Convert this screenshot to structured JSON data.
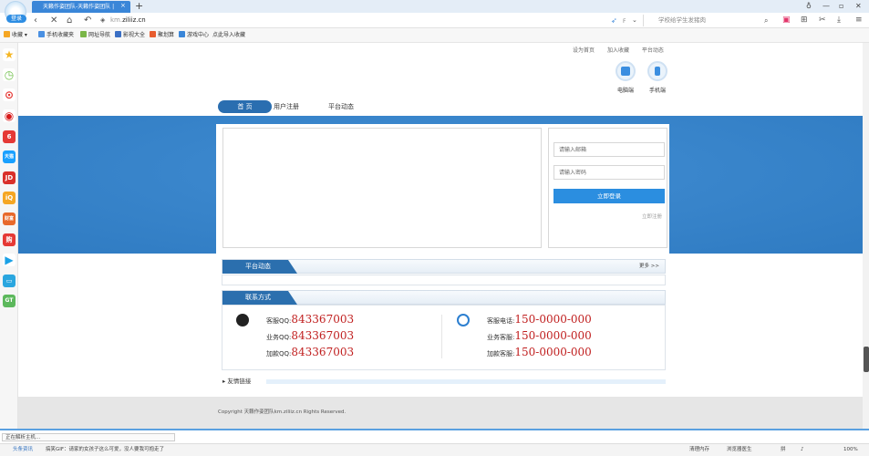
{
  "browser": {
    "login_label": "登录",
    "tab_title": "天籁作姿团队-天籁作姿团队 |",
    "tab_close": "×",
    "new_tab": "+",
    "address_prefix": "km.",
    "address_domain": "ziliiz.cn",
    "search_engine_label": "F",
    "search_placeholder": "学校给学生发猪肉",
    "icons": [
      "back-icon",
      "close-icon",
      "home-icon",
      "undo-icon",
      "shield-icon",
      "lightning-icon",
      "search-icon",
      "minimize-icon",
      "maximize-icon",
      "window-close-icon",
      "menu-icon"
    ]
  },
  "bookmarks": [
    {
      "label": "收藏",
      "color": "#f5a623"
    },
    {
      "label": "手机收藏夹",
      "color": "#4a90e2"
    },
    {
      "label": "网址导航",
      "color": "#7ab648"
    },
    {
      "label": "影视大全",
      "color": "#3a6fc4"
    },
    {
      "label": "聚划算",
      "color": "#e85d2f"
    },
    {
      "label": "游戏中心",
      "color": "#3a86d8"
    },
    {
      "label": "点此导入收藏",
      "color": "#cccccc"
    }
  ],
  "sidebar": [
    {
      "name": "favorites",
      "glyph": "★",
      "bg": "#f5b623"
    },
    {
      "name": "history",
      "glyph": "◷",
      "bg": "#6fbf4a"
    },
    {
      "name": "video",
      "glyph": "▶",
      "bg": "#e53935"
    },
    {
      "name": "live",
      "glyph": "●",
      "bg": "#d81b1b"
    },
    {
      "name": "weibo",
      "glyph": "6",
      "bg": "#e53935"
    },
    {
      "name": "tmall",
      "glyph": "天猫",
      "bg": "#19a0ff"
    },
    {
      "name": "jd",
      "glyph": "JD",
      "bg": "#d9302a"
    },
    {
      "name": "iqiyi",
      "glyph": "iQ",
      "bg": "#f5a623"
    },
    {
      "name": "finance",
      "glyph": "财富",
      "bg": "#e8692b"
    },
    {
      "name": "shop",
      "glyph": "购",
      "bg": "#e53935"
    },
    {
      "name": "player",
      "glyph": "▶",
      "bg": "#1aa1e6"
    },
    {
      "name": "tv",
      "glyph": "☐",
      "bg": "#2aa6df"
    },
    {
      "name": "app",
      "glyph": "GT",
      "bg": "#5cb85c"
    }
  ],
  "site": {
    "top_links": [
      "设为首页",
      "加入收藏",
      "平台动态"
    ],
    "downloads": [
      {
        "label": "电脑端",
        "icon": "computer-icon"
      },
      {
        "label": "手机端",
        "icon": "mobile-icon"
      }
    ],
    "menu": [
      "首 页",
      "用户注册",
      "平台动态"
    ],
    "login": {
      "email_placeholder": "请输入邮箱",
      "password_placeholder": "请输入密码",
      "submit": "立即登录",
      "register": "立即注册"
    },
    "news_title": "平台动态",
    "more": "更多 >>",
    "contact_title": "联系方式",
    "qq": [
      {
        "label": "客服QQ:",
        "value": "843367003"
      },
      {
        "label": "业务QQ:",
        "value": "843367003"
      },
      {
        "label": "加款QQ:",
        "value": "843367003"
      }
    ],
    "phones": [
      {
        "label": "客服电话:",
        "value": "150-0000-000"
      },
      {
        "label": "业务客服:",
        "value": "150-0000-000"
      },
      {
        "label": "加款客服:",
        "value": "150-0000-000"
      }
    ],
    "friend_links": "友情链接",
    "copyright": "Copyright 天籁作姿团队km.ziliiz.cn Rights Reserved."
  },
  "status": {
    "loading": "正在解析主机...",
    "news_source": "头条资讯",
    "news_text": "搞笑GIF：请家的女孩子这么可爱，没人要我可抱走了",
    "accelerate": "加速器",
    "memory": "清理内存",
    "doctor": "浏览器医生",
    "ime": "拼",
    "zoom": "100%"
  }
}
